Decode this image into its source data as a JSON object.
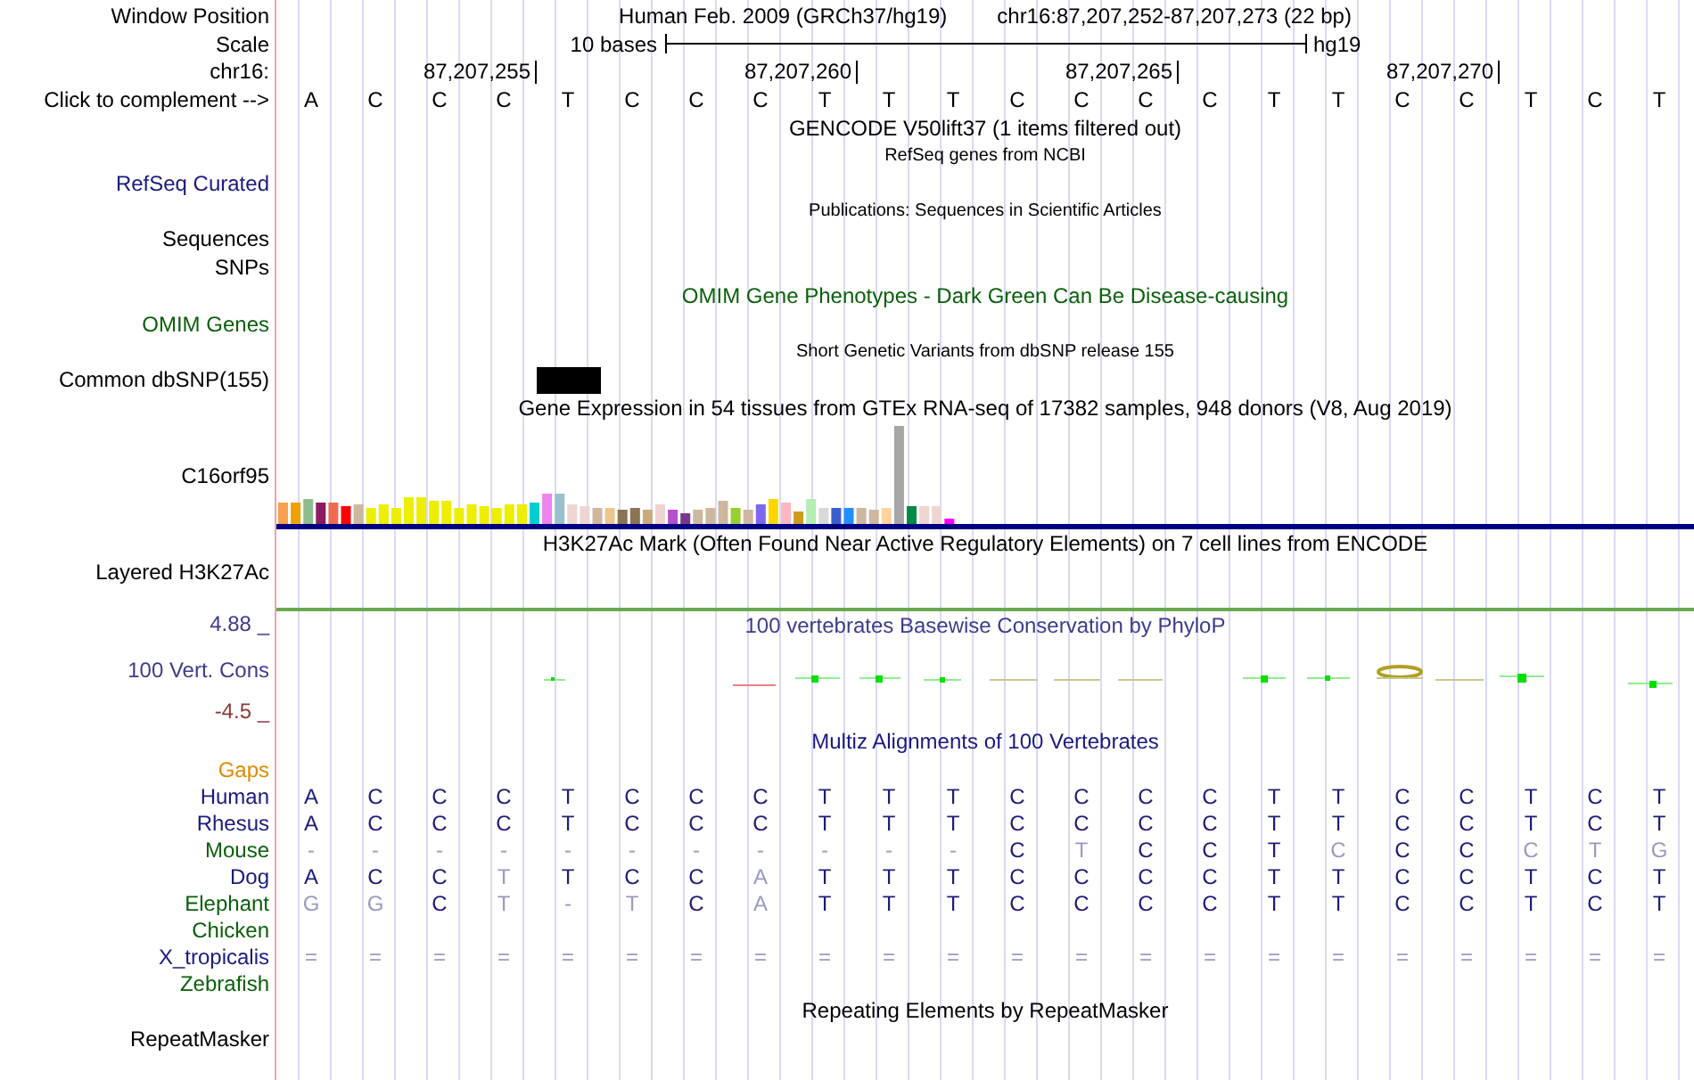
{
  "ruler": {
    "window_position_label": "Window Position",
    "assembly": "Human Feb. 2009 (GRCh37/hg19)",
    "position": "chr16:87,207,252-87,207,273 (22 bp)",
    "scale_label": "Scale",
    "scale_text": "10 bases",
    "scale_db": "hg19",
    "chrom_label": "chr16:",
    "ticks": [
      "87,207,255",
      "87,207,260",
      "87,207,265",
      "87,207,270"
    ],
    "complement_label": "Click to complement -->",
    "bases": [
      "A",
      "C",
      "C",
      "C",
      "T",
      "C",
      "C",
      "C",
      "T",
      "T",
      "T",
      "C",
      "C",
      "C",
      "C",
      "T",
      "T",
      "C",
      "C",
      "T",
      "C",
      "T"
    ]
  },
  "tracks": [
    {
      "kind": "title",
      "text": "GENCODE V50lift37 (1 items filtered out)",
      "color": "#000000"
    },
    {
      "kind": "subtitle",
      "text": "RefSeq genes from NCBI"
    },
    {
      "kind": "label",
      "label": "RefSeq Curated",
      "color": "#1a1a80"
    },
    {
      "kind": "subtitle",
      "text": "Publications: Sequences in Scientific Articles"
    },
    {
      "kind": "label",
      "label": "Sequences",
      "color": "#000000"
    },
    {
      "kind": "label",
      "label": "SNPs",
      "color": "#000000"
    },
    {
      "kind": "title",
      "text": "OMIM Gene Phenotypes - Dark Green Can Be Disease-causing",
      "color": "#0a600a"
    },
    {
      "kind": "label",
      "label": "OMIM Genes",
      "color": "#0a600a"
    },
    {
      "kind": "subtitle",
      "text": "Short Genetic Variants from dbSNP release 155"
    },
    {
      "kind": "snp",
      "label": "Common dbSNP(155)",
      "color": "#000000"
    },
    {
      "kind": "title",
      "text": "Gene Expression in 54 tissues from GTEx RNA-seq of 17382 samples, 948 donors (V8, Aug 2019)",
      "color": "#000000"
    },
    {
      "kind": "expression",
      "label": "C16orf95"
    },
    {
      "kind": "title",
      "text": "H3K27Ac Mark (Often Found Near Active Regulatory Elements) on 7 cell lines from ENCODE",
      "color": "#000000"
    },
    {
      "kind": "label",
      "label": "Layered H3K27Ac",
      "color": "#000000"
    },
    {
      "kind": "conservation",
      "title": "100 vertebrates Basewise Conservation by PhyloP",
      "label": "100 Vert. Cons",
      "max": "4.88 _",
      "min": "-4.5 _"
    },
    {
      "kind": "title",
      "text": "Multiz Alignments of 100 Vertebrates",
      "color": "#1a1a80"
    },
    {
      "kind": "alignment",
      "species": [
        {
          "name": "Gaps",
          "color": "#e08a00"
        },
        {
          "name": "Human",
          "color": "#1a1a80",
          "bases": [
            {
              "base": "A",
              "dim": false
            },
            {
              "base": "C",
              "dim": false
            },
            {
              "base": "C",
              "dim": false
            },
            {
              "base": "C",
              "dim": false
            },
            {
              "base": "T",
              "dim": false
            },
            {
              "base": "C",
              "dim": false
            },
            {
              "base": "C",
              "dim": false
            },
            {
              "base": "C",
              "dim": false
            },
            {
              "base": "T",
              "dim": false
            },
            {
              "base": "T",
              "dim": false
            },
            {
              "base": "T",
              "dim": false
            },
            {
              "base": "C",
              "dim": false
            },
            {
              "base": "C",
              "dim": false
            },
            {
              "base": "C",
              "dim": false
            },
            {
              "base": "C",
              "dim": false
            },
            {
              "base": "T",
              "dim": false
            },
            {
              "base": "T",
              "dim": false
            },
            {
              "base": "C",
              "dim": false
            },
            {
              "base": "C",
              "dim": false
            },
            {
              "base": "T",
              "dim": false
            },
            {
              "base": "C",
              "dim": false
            },
            {
              "base": "T",
              "dim": false
            }
          ]
        },
        {
          "name": "Rhesus",
          "color": "#1a1a80",
          "bases": [
            {
              "base": "A",
              "dim": false
            },
            {
              "base": "C",
              "dim": false
            },
            {
              "base": "C",
              "dim": false
            },
            {
              "base": "C",
              "dim": false
            },
            {
              "base": "T",
              "dim": false
            },
            {
              "base": "C",
              "dim": false
            },
            {
              "base": "C",
              "dim": false
            },
            {
              "base": "C",
              "dim": false
            },
            {
              "base": "T",
              "dim": false
            },
            {
              "base": "T",
              "dim": false
            },
            {
              "base": "T",
              "dim": false
            },
            {
              "base": "C",
              "dim": false
            },
            {
              "base": "C",
              "dim": false
            },
            {
              "base": "C",
              "dim": false
            },
            {
              "base": "C",
              "dim": false
            },
            {
              "base": "T",
              "dim": false
            },
            {
              "base": "T",
              "dim": false
            },
            {
              "base": "C",
              "dim": false
            },
            {
              "base": "C",
              "dim": false
            },
            {
              "base": "T",
              "dim": false
            },
            {
              "base": "C",
              "dim": false
            },
            {
              "base": "T",
              "dim": false
            }
          ]
        },
        {
          "name": "Mouse",
          "color": "#0a600a",
          "bases": [
            {
              "base": "-",
              "dim": true
            },
            {
              "base": "-",
              "dim": true
            },
            {
              "base": "-",
              "dim": true
            },
            {
              "base": "-",
              "dim": true
            },
            {
              "base": "-",
              "dim": true
            },
            {
              "base": "-",
              "dim": true
            },
            {
              "base": "-",
              "dim": true
            },
            {
              "base": "-",
              "dim": true
            },
            {
              "base": "-",
              "dim": true
            },
            {
              "base": "-",
              "dim": true
            },
            {
              "base": "-",
              "dim": true
            },
            {
              "base": "C",
              "dim": false
            },
            {
              "base": "T",
              "dim": true
            },
            {
              "base": "C",
              "dim": false
            },
            {
              "base": "C",
              "dim": false
            },
            {
              "base": "T",
              "dim": false
            },
            {
              "base": "C",
              "dim": true
            },
            {
              "base": "C",
              "dim": false
            },
            {
              "base": "C",
              "dim": false
            },
            {
              "base": "C",
              "dim": true
            },
            {
              "base": "T",
              "dim": true
            },
            {
              "base": "G",
              "dim": true
            }
          ]
        },
        {
          "name": "Dog",
          "color": "#1a1a80",
          "bases": [
            {
              "base": "A",
              "dim": false
            },
            {
              "base": "C",
              "dim": false
            },
            {
              "base": "C",
              "dim": false
            },
            {
              "base": "T",
              "dim": true
            },
            {
              "base": "T",
              "dim": false
            },
            {
              "base": "C",
              "dim": false
            },
            {
              "base": "C",
              "dim": false
            },
            {
              "base": "A",
              "dim": true
            },
            {
              "base": "T",
              "dim": false
            },
            {
              "base": "T",
              "dim": false
            },
            {
              "base": "T",
              "dim": false
            },
            {
              "base": "C",
              "dim": false
            },
            {
              "base": "C",
              "dim": false
            },
            {
              "base": "C",
              "dim": false
            },
            {
              "base": "C",
              "dim": false
            },
            {
              "base": "T",
              "dim": false
            },
            {
              "base": "T",
              "dim": false
            },
            {
              "base": "C",
              "dim": false
            },
            {
              "base": "C",
              "dim": false
            },
            {
              "base": "T",
              "dim": false
            },
            {
              "base": "C",
              "dim": false
            },
            {
              "base": "T",
              "dim": false
            }
          ]
        },
        {
          "name": "Elephant",
          "color": "#0a600a",
          "bases": [
            {
              "base": "G",
              "dim": true
            },
            {
              "base": "G",
              "dim": true
            },
            {
              "base": "C",
              "dim": false
            },
            {
              "base": "T",
              "dim": true
            },
            {
              "base": "-",
              "dim": true
            },
            {
              "base": "T",
              "dim": true
            },
            {
              "base": "C",
              "dim": false
            },
            {
              "base": "A",
              "dim": true
            },
            {
              "base": "T",
              "dim": false
            },
            {
              "base": "T",
              "dim": false
            },
            {
              "base": "T",
              "dim": false
            },
            {
              "base": "C",
              "dim": false
            },
            {
              "base": "C",
              "dim": false
            },
            {
              "base": "C",
              "dim": false
            },
            {
              "base": "C",
              "dim": false
            },
            {
              "base": "T",
              "dim": false
            },
            {
              "base": "T",
              "dim": false
            },
            {
              "base": "C",
              "dim": false
            },
            {
              "base": "C",
              "dim": false
            },
            {
              "base": "T",
              "dim": false
            },
            {
              "base": "C",
              "dim": false
            },
            {
              "base": "T",
              "dim": false
            }
          ]
        },
        {
          "name": "Chicken",
          "color": "#0a600a"
        },
        {
          "name": "X_tropicalis",
          "color": "#1a1a80",
          "bases": [
            {
              "base": "=",
              "dim": true
            },
            {
              "base": "=",
              "dim": true
            },
            {
              "base": "=",
              "dim": true
            },
            {
              "base": "=",
              "dim": true
            },
            {
              "base": "=",
              "dim": true
            },
            {
              "base": "=",
              "dim": true
            },
            {
              "base": "=",
              "dim": true
            },
            {
              "base": "=",
              "dim": true
            },
            {
              "base": "=",
              "dim": true
            },
            {
              "base": "=",
              "dim": true
            },
            {
              "base": "=",
              "dim": true
            },
            {
              "base": "=",
              "dim": true
            },
            {
              "base": "=",
              "dim": true
            },
            {
              "base": "=",
              "dim": true
            },
            {
              "base": "=",
              "dim": true
            },
            {
              "base": "=",
              "dim": true
            },
            {
              "base": "=",
              "dim": true
            },
            {
              "base": "=",
              "dim": true
            },
            {
              "base": "=",
              "dim": true
            },
            {
              "base": "=",
              "dim": true
            },
            {
              "base": "=",
              "dim": true
            },
            {
              "base": "=",
              "dim": true
            }
          ]
        },
        {
          "name": "Zebrafish",
          "color": "#0a600a"
        }
      ]
    },
    {
      "kind": "title",
      "text": "Repeating Elements by RepeatMasker",
      "color": "#000000"
    },
    {
      "kind": "label",
      "label": "RepeatMasker",
      "color": "#000000"
    }
  ]
}
